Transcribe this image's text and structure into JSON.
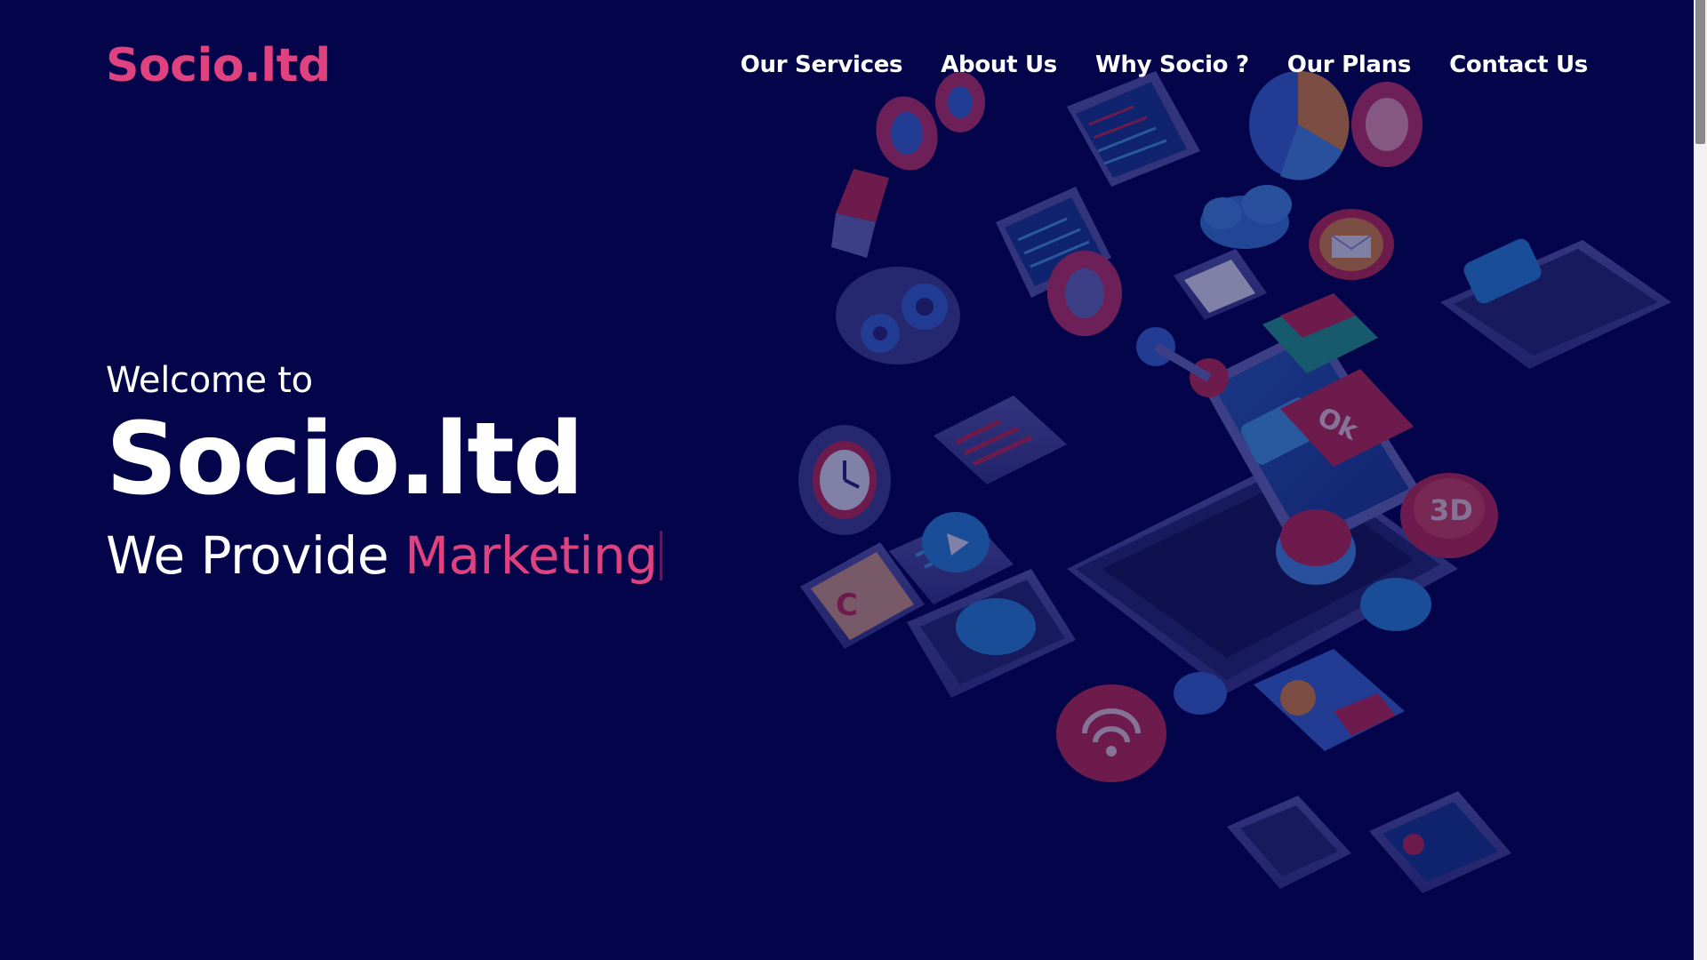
{
  "brand": {
    "logo_text": "Socio.ltd",
    "accent_color": "#e0417f",
    "background_color": "#03044a"
  },
  "nav": {
    "items": [
      {
        "label": "Our Services"
      },
      {
        "label": "About Us"
      },
      {
        "label": "Why Socio ?"
      },
      {
        "label": "Our Plans"
      },
      {
        "label": "Contact Us"
      }
    ]
  },
  "hero": {
    "welcome": "Welcome to",
    "title": "Socio.ltd",
    "provide_prefix": "We Provide",
    "provide_highlight": "Marketing"
  },
  "illustration": {
    "icons": [
      "laptop-icon",
      "chat-bubble-icon",
      "cloud-icon",
      "gear-icon",
      "clock-icon",
      "phone-icon",
      "wifi-icon",
      "email-icon",
      "3d-badge-icon",
      "code-window-icon",
      "chart-icon",
      "arrow-icon"
    ],
    "badge_texts": {
      "three_d": "3D",
      "ok": "Ok"
    }
  }
}
